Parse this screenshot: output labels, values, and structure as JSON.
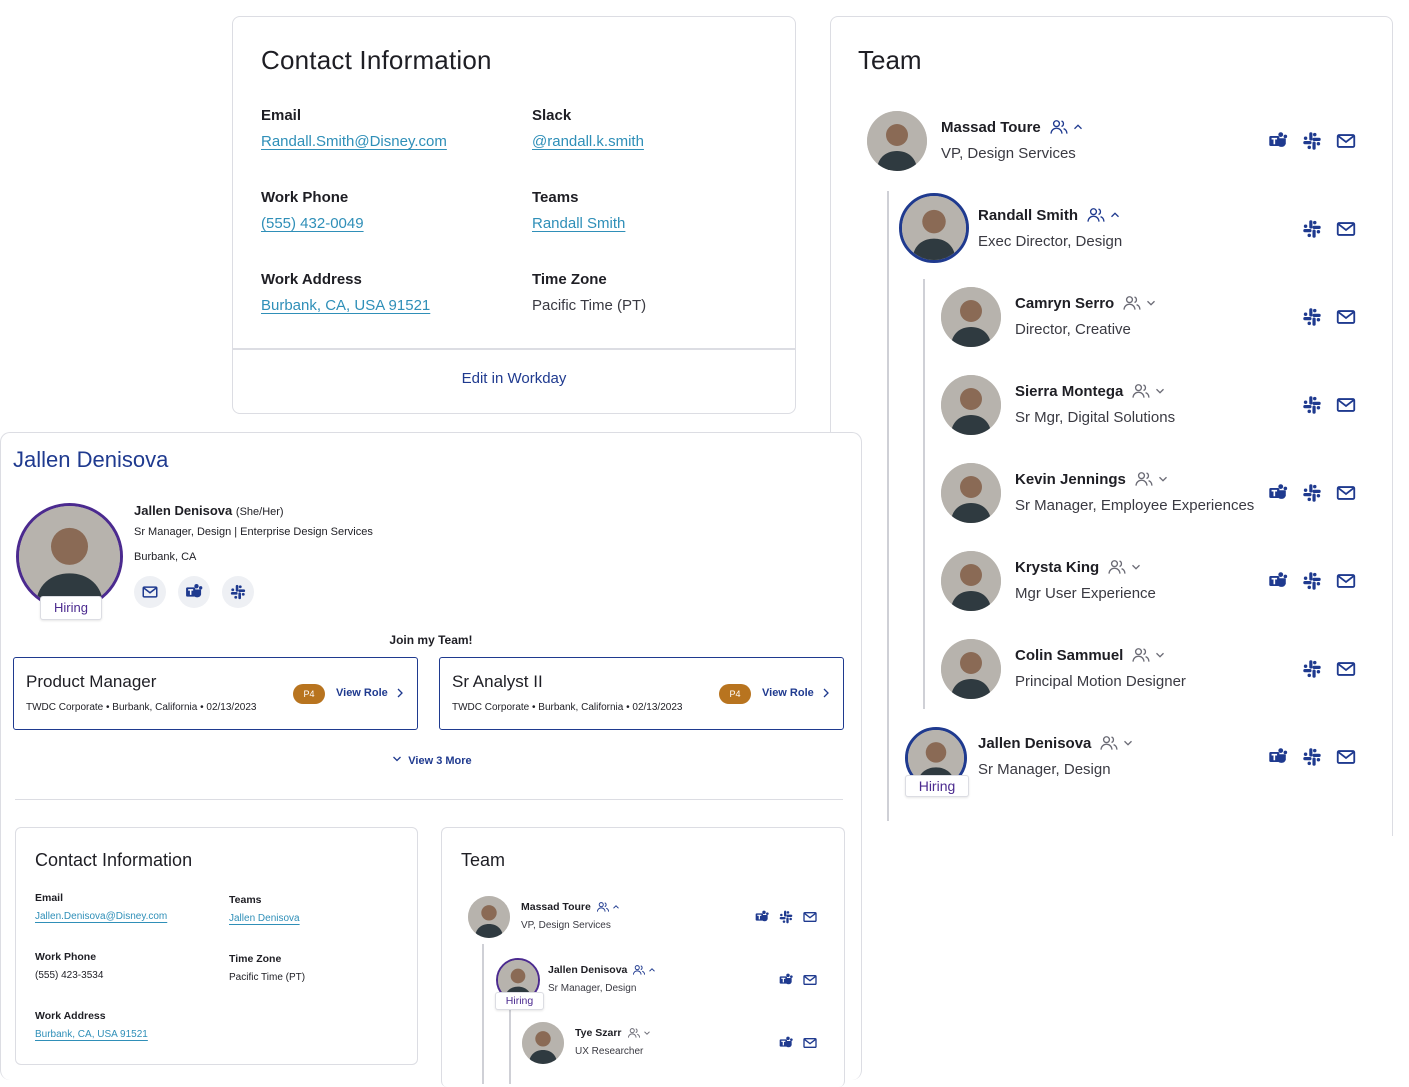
{
  "top_contact": {
    "title": "Contact Information",
    "email_label": "Email",
    "email_value": "Randall.Smith@Disney.com",
    "slack_label": "Slack",
    "slack_value": "@randall.k.smith",
    "phone_label": "Work Phone",
    "phone_value": "(555) 432-0049",
    "teams_label": "Teams",
    "teams_value": "Randall Smith",
    "address_label": "Work Address",
    "address_value": "Burbank, CA, USA 91521",
    "tz_label": "Time Zone",
    "tz_value": "Pacific Time (PT)",
    "edit_label": "Edit in Workday"
  },
  "team_right": {
    "title": "Team",
    "members": [
      {
        "name": "Massad Toure",
        "title": "VP, Design Services",
        "chevron": "up"
      },
      {
        "name": "Randall Smith",
        "title": "Exec Director, Design",
        "chevron": "up"
      },
      {
        "name": "Camryn Serro",
        "title": "Director, Creative",
        "chevron": "down"
      },
      {
        "name": "Sierra Montega",
        "title": "Sr Mgr, Digital Solutions",
        "chevron": "down"
      },
      {
        "name": "Kevin Jennings",
        "title": "Sr Manager, Employee Experiences",
        "chevron": "down"
      },
      {
        "name": "Krysta King",
        "title": "Mgr User Experience",
        "chevron": "down"
      },
      {
        "name": "Colin Sammuel",
        "title": "Principal Motion Designer",
        "chevron": "down"
      },
      {
        "name": "Jallen Denisova",
        "title": "Sr Manager, Design",
        "chevron": "down",
        "badge": "Hiring"
      }
    ]
  },
  "profile": {
    "heading": "Jallen Denisova",
    "name": "Jallen Denisova",
    "pronouns": "(She/Her)",
    "role_line": "Sr Manager, Design | Enterprise Design Services",
    "location": "Burbank, CA",
    "badge": "Hiring",
    "join_text": "Join my Team!",
    "roles": [
      {
        "title": "Product Manager",
        "meta": "TWDC Corporate • Burbank, California • 02/13/2023",
        "level": "P4",
        "action": "View Role"
      },
      {
        "title": "Sr Analyst II",
        "meta": "TWDC Corporate • Burbank, California • 02/13/2023",
        "level": "P4",
        "action": "View Role"
      }
    ],
    "view_more": "View 3 More"
  },
  "bottom_contact": {
    "title": "Contact Information",
    "email_label": "Email",
    "email_value": "Jallen.Denisova@Disney.com",
    "teams_label": "Teams",
    "teams_value": "Jallen Denisova",
    "phone_label": "Work Phone",
    "phone_value": "(555) 423-3534",
    "tz_label": "Time Zone",
    "tz_value": "Pacific Time (PT)",
    "address_label": "Work Address",
    "address_value": "Burbank, CA, USA 91521"
  },
  "bottom_team": {
    "title": "Team",
    "members": [
      {
        "name": "Massad Toure",
        "title": "VP, Design Services"
      },
      {
        "name": "Jallen Denisova",
        "title": "Sr Manager, Design",
        "badge": "Hiring"
      },
      {
        "name": "Tye Szarr",
        "title": "UX Researcher"
      }
    ]
  },
  "colors": {
    "navy": "#1f3a8f",
    "link": "#2f8fb8",
    "hiring": "#4b2a8f",
    "pill": "#b8741f"
  },
  "icons": [
    "teams-icon",
    "slack-icon",
    "mail-icon",
    "people-icon",
    "chevron-up-icon",
    "chevron-down-icon",
    "chevron-right-icon"
  ]
}
